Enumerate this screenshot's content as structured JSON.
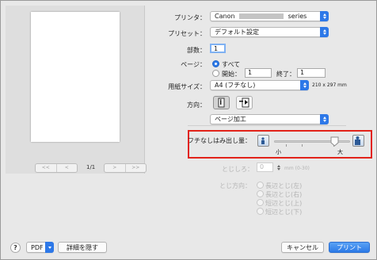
{
  "preview": {
    "prev_first": "<<",
    "prev": "<",
    "next": ">",
    "next_last": ">>",
    "page_indicator": "1/1"
  },
  "printer": {
    "label": "プリンタ：",
    "value_prefix": "Canon",
    "value_suffix": "series"
  },
  "presets": {
    "label": "プリセット：",
    "value": "デフォルト設定"
  },
  "copies": {
    "label": "部数：",
    "value": "1"
  },
  "pages": {
    "label": "ページ：",
    "all_label": "すべて",
    "from_label": "開始：",
    "from_value": "1",
    "to_label": "終了：",
    "to_value": "1"
  },
  "paper_size": {
    "label": "用紙サイズ：",
    "value": "A4 (フチなし)",
    "dimensions": "210 x 297 mm"
  },
  "orientation": {
    "label": "方向："
  },
  "section": {
    "value": "ページ加工"
  },
  "borderless_extension": {
    "label": "フチなしはみ出し量：",
    "min_label": "小",
    "max_label": "大",
    "level": 0.8
  },
  "binding_margin": {
    "label": "とじしろ：",
    "value": "0",
    "unit": "mm (0-30)"
  },
  "binding_side": {
    "label": "とじ方向：",
    "options": [
      "長辺とじ(左)",
      "長辺とじ(右)",
      "短辺とじ(上)",
      "短辺とじ(下)"
    ]
  },
  "footer": {
    "help": "?",
    "pdf": "PDF",
    "hide_details": "詳細を隠す",
    "cancel": "キャンセル",
    "print": "プリント"
  },
  "colors": {
    "accent": "#2d78e8",
    "highlight": "#e2231a"
  }
}
